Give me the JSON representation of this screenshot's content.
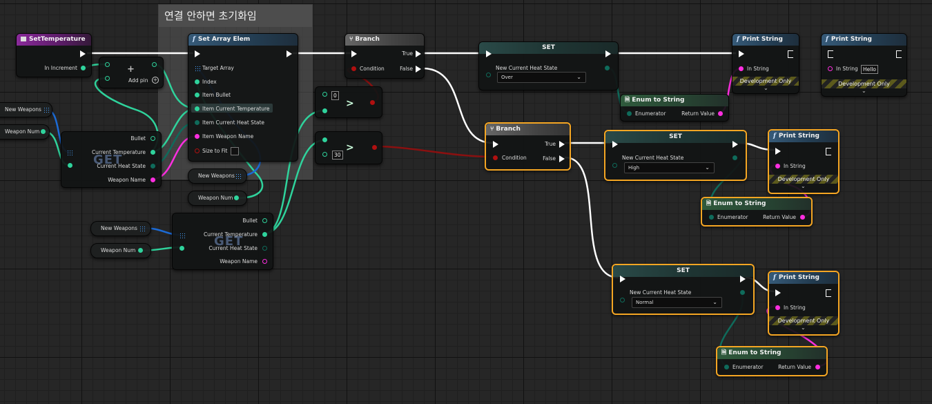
{
  "comment": {
    "title": "연결 안하면 초기화임"
  },
  "colors": {
    "exec": "#ffffff",
    "float": "#2fd39c",
    "enum": "#0f6b5b",
    "string": "#ff2ee0",
    "bool": "#b01010",
    "struct_array": "#1c6bd6",
    "int": "#2ed3b0"
  },
  "event": {
    "title": "SetTemperature",
    "pin": "In Increment"
  },
  "add_node": {
    "label": "Add pin"
  },
  "set_array": {
    "title": "Set Array Elem",
    "pins": [
      "Target Array",
      "Index",
      "Item Bullet",
      "Item Current Temperature",
      "Item Current Heat State",
      "Item Weapon Name",
      "Size to Fit"
    ]
  },
  "get1": {
    "watermark": "GET",
    "pins": [
      "Bullet",
      "Current Temperature",
      "Current Heat State",
      "Weapon Name"
    ]
  },
  "get2": {
    "watermark": "GET",
    "pins": [
      "Bullet",
      "Current Temperature",
      "Current Heat State",
      "Weapon Name"
    ]
  },
  "vars": {
    "new_weapons": "New Weapons",
    "weapon_num": "Weapon Num"
  },
  "compare1": {
    "value": "0",
    "op": ">"
  },
  "compare2": {
    "value": "30",
    "op": ">"
  },
  "branch1": {
    "title": "Branch",
    "true": "True",
    "false": "False",
    "cond": "Condition"
  },
  "branch2": {
    "title": "Branch",
    "true": "True",
    "false": "False",
    "cond": "Condition"
  },
  "set1": {
    "title": "SET",
    "label": "New Current Heat State",
    "value": "Over"
  },
  "set2": {
    "title": "SET",
    "label": "New Current Heat State",
    "value": "High"
  },
  "set3": {
    "title": "SET",
    "label": "New Current Heat State",
    "value": "Normal"
  },
  "print1": {
    "title": "Print String",
    "pin": "In String",
    "dev": "Development Only"
  },
  "print2": {
    "title": "Print String",
    "pin": "In String",
    "value": "Hello",
    "dev": "Development Only"
  },
  "print3": {
    "title": "Print String",
    "pin": "In String",
    "dev": "Development Only"
  },
  "print4": {
    "title": "Print String",
    "pin": "In String",
    "dev": "Development Only"
  },
  "enum1": {
    "title": "Enum to String",
    "in": "Enumerator",
    "out": "Return Value"
  },
  "enum2": {
    "title": "Enum to String",
    "in": "Enumerator",
    "out": "Return Value"
  },
  "enum3": {
    "title": "Enum to String",
    "in": "Enumerator",
    "out": "Return Value"
  }
}
